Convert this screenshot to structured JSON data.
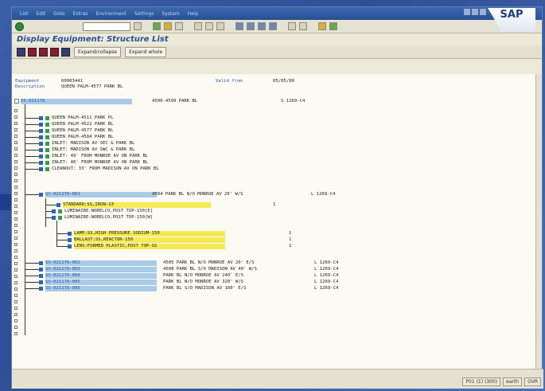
{
  "window": {
    "menu": [
      "List",
      "Edit",
      "Goto",
      "Extras",
      "Environment",
      "Settings",
      "System",
      "Help"
    ],
    "logo": "SAP"
  },
  "screen_title": "Display Equipment: Structure List",
  "app_toolbar": {
    "expand_collapse": "Expand/collapse",
    "expand_whole": "Expand whole"
  },
  "header": {
    "equipment_label": "Equipment",
    "equipment_value": "60003441",
    "valid_from_label": "Valid from",
    "valid_from_value": "05/05/00",
    "description_label": "Description",
    "description_value": "QUEEN PALM-4577 PARK BL"
  },
  "root": {
    "id": "SS-021176",
    "desc": "4500-4599 PARK BL",
    "loc": "S 1269-C4"
  },
  "items": [
    {
      "text": "QUEEN PALM-4511 PARK PL",
      "type": "T"
    },
    {
      "text": "QUEEN PALM-4522 PARK BL",
      "type": "T"
    },
    {
      "text": "QUEEN PALM-4577 PARK BL",
      "type": "T"
    },
    {
      "text": "QUEEN PALM-4584 PARK BL",
      "type": "T"
    },
    {
      "text": "INLET: MADISON AV SEC & PARK BL",
      "type": "D"
    },
    {
      "text": "INLET: MADISON AV SWC & PARK BL",
      "type": "D"
    },
    {
      "text": "INLET: 49' FROM MONROE AV ON PARK BL",
      "type": "D"
    },
    {
      "text": "INLET: 46' FROM MONROE AV ON PARK BL",
      "type": "D"
    },
    {
      "text": "CLEANOUT: 33' FROM MADISON AV ON PARK BL",
      "type": "D"
    }
  ],
  "sub_root": {
    "id": "SS-021176-001",
    "desc": "4504 PARK BL N/O MONROE AV 20' W/S",
    "loc": "L 1269-C4"
  },
  "standard": {
    "text": "STANDARD:SS,IRON-13",
    "qty": "1"
  },
  "luminaires": [
    {
      "text": "LUMINAIRE:NORELCO,POST TOP-150[E]",
      "type": "L"
    },
    {
      "text": "LUMINAIRE:NORELCO,POST TOP-150[W]",
      "type": "L"
    }
  ],
  "components": [
    {
      "text": "LAMP:SS,HIGH PRESSURE SODIUM-150",
      "qty": "1"
    },
    {
      "text": "BALLAST:SS,REACTOR-150",
      "qty": "1"
    },
    {
      "text": "LENS:FORMED PLASTIC,POST TOP-SS",
      "qty": "1"
    }
  ],
  "siblings": [
    {
      "id": "SS-021176-002",
      "desc": "4505 PARK BL N/O MONROE AV 20' E/S",
      "loc": "L 1269-C4"
    },
    {
      "id": "SS-021176-003",
      "desc": "4508 PARK BL S/O MADISON AV 40' W/S",
      "loc": "L 1269-C4"
    },
    {
      "id": "SS-021176-004",
      "desc": "PARK BL N/O MONROE AV 240' E/S",
      "loc": "L 1269-C4"
    },
    {
      "id": "SS-021176-005",
      "desc": "PARK BL N/O MONROE AV 320' W/S",
      "loc": "L 1269-C4"
    },
    {
      "id": "SS-021176-006",
      "desc": "PARK BL S/O MADISON AV 160' E/S",
      "loc": "L 1269-C4"
    }
  ],
  "status": {
    "session": "P01 (1) (300)",
    "server": "earth",
    "mode": "OVR"
  }
}
